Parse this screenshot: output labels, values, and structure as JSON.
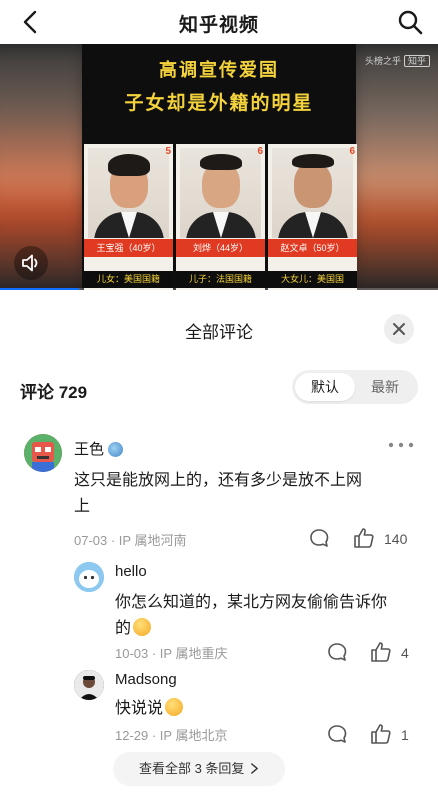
{
  "header": {
    "title": "知乎视频"
  },
  "video": {
    "headline_line1": "高调宣传爱国",
    "headline_line2": "子女却是外籍的明星",
    "watermark_text": "头榜之乎",
    "watermark_badge": "知乎",
    "progress": 0.18,
    "cards": [
      {
        "num": "5",
        "name": "王宝强（40岁）",
        "caption": "儿女：美国国籍"
      },
      {
        "num": "6",
        "name": "刘烨（44岁）",
        "caption": "儿子：法国国籍"
      },
      {
        "num": "6",
        "name": "赵文卓（50岁）",
        "caption": "大女儿：美国国"
      }
    ]
  },
  "comments_sheet": {
    "title": "全部评论",
    "count_label": "评论 729",
    "sort": {
      "active": "默认",
      "inactive": "最新"
    }
  },
  "comment": {
    "user": "王色",
    "line1": "这只是能放网上的，还有多少是放不上网",
    "line2": "上",
    "meta": "07-03 · IP 属地河南",
    "likes": "140"
  },
  "replies": [
    {
      "user": "hello",
      "line1": "你怎么知道的，某北方网友偷偷告诉你",
      "line2": "的",
      "meta": "10-03 · IP 属地重庆",
      "likes": "4"
    },
    {
      "user": "Madsong",
      "line1": "快说说",
      "meta": "12-29 · IP 属地北京",
      "likes": "1"
    }
  ],
  "view_replies_label": "查看全部 3 条回复",
  "colors": {
    "accent": "#0f6fff",
    "headline_yellow": "#f3d23c",
    "name_red": "#e03b22"
  }
}
